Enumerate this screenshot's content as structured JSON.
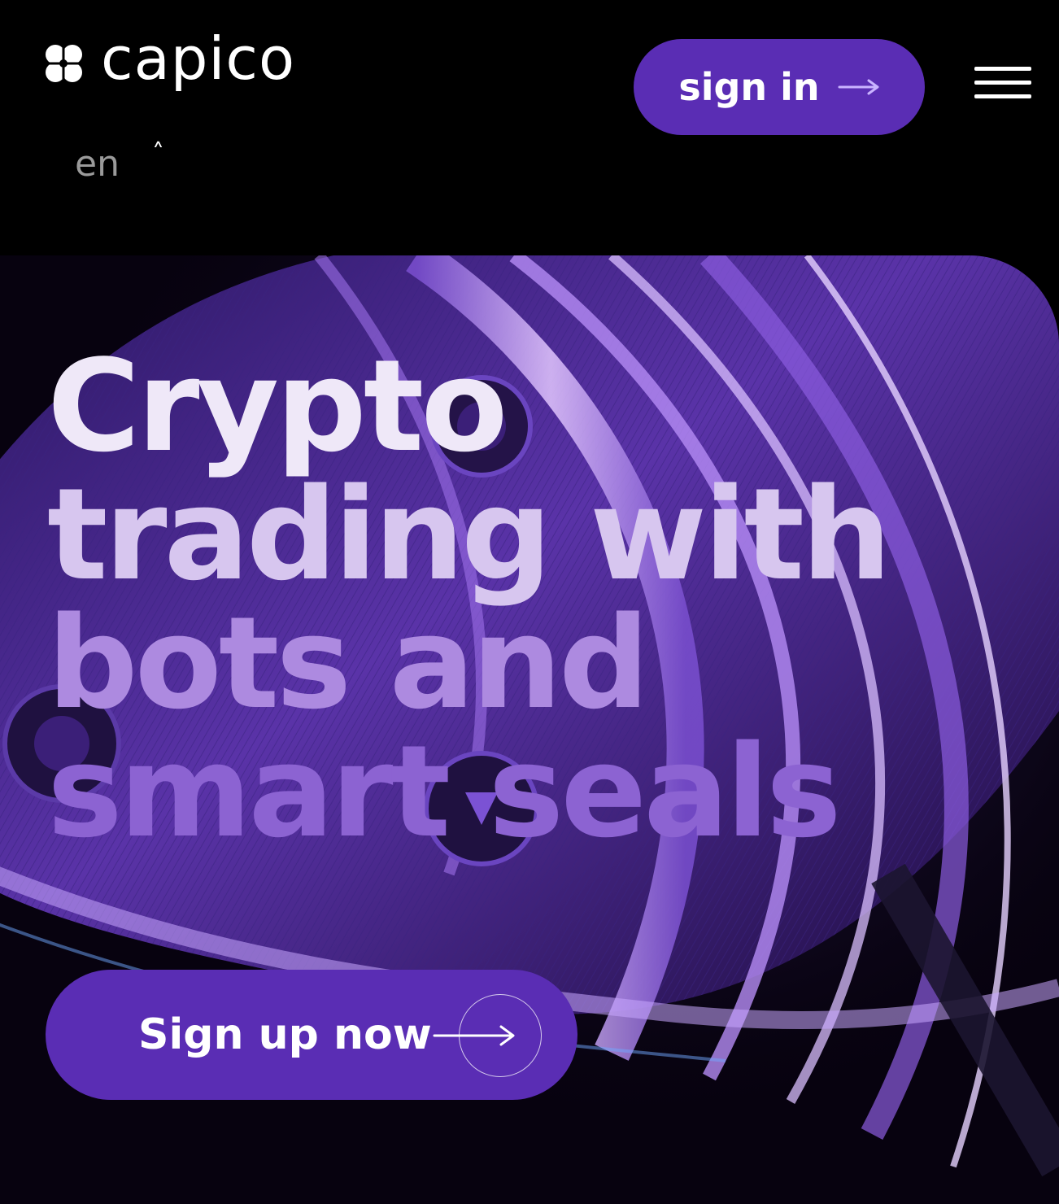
{
  "header": {
    "brand": "capico",
    "sign_in_label": "sign in",
    "language": "en"
  },
  "hero": {
    "headline_lines": [
      "Crypto",
      "trading with",
      "bots and",
      "smart seals"
    ],
    "cta_label": "Sign up now"
  },
  "icons": {
    "logo": "clover-logo-icon",
    "sign_in_arrow": "arrow-right-icon",
    "menu": "hamburger-menu-icon",
    "language_toggle": "chevron-up-icon",
    "cta_arrow": "arrow-right-circle-icon"
  },
  "colors": {
    "background": "#000000",
    "button": "#5a2db4",
    "text": "#ffffff",
    "muted": "#9a9a9a",
    "accent_light": "#d6b8ff"
  }
}
